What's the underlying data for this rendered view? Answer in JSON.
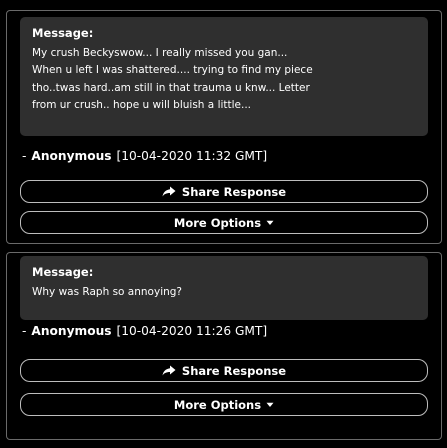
{
  "responses": [
    {
      "label": "Message:",
      "lines": [
        "My crush Beckyswow... I really missed you gan...",
        "When u left I was shattered.... trying to find my piece",
        "tho..twas hard..am still in that trauma u knw... Letter",
        "from ur crush.. hope u will bluish a little..."
      ],
      "sender_dash": "-",
      "sender_name": "Anonymous",
      "sender_time": "[10-04-2020 11:32 GMT]",
      "share_label": "Share Response",
      "more_label": "More Options"
    },
    {
      "label": "Message:",
      "lines": [
        "Why was Raph so annoying?"
      ],
      "sender_dash": "-",
      "sender_name": "Anonymous",
      "sender_time": "[10-04-2020 11:26 GMT]",
      "share_label": "Share Response",
      "more_label": "More Options"
    }
  ],
  "icons": {
    "share": "share-arrow-icon",
    "more": "chevron-down-icon"
  },
  "colors": {
    "background": "#000000",
    "message_box": "#2f2f2f",
    "card_border": "#6a6a6a",
    "button_border": "#bdbdbd",
    "text": "#ffffff"
  }
}
